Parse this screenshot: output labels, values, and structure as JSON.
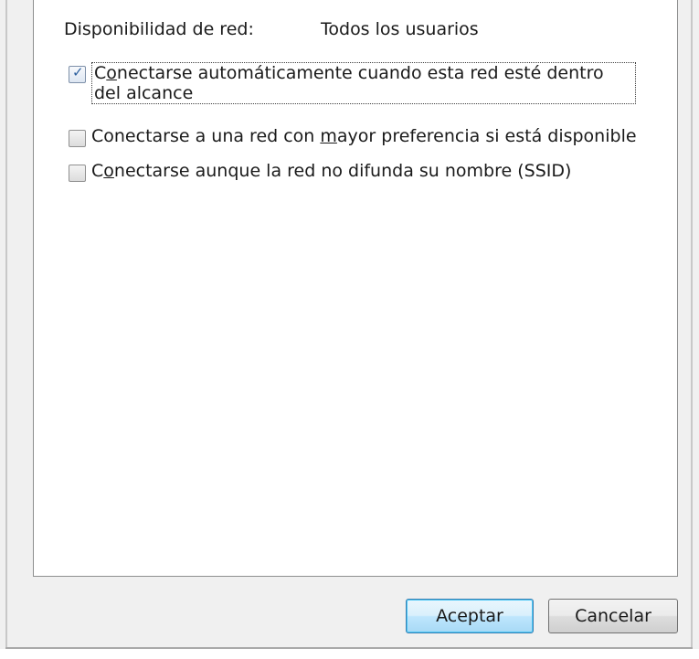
{
  "availability": {
    "label": "Disponibilidad de red:",
    "value": "Todos los usuarios"
  },
  "options": [
    {
      "label_prefix": "C",
      "label_accel": "o",
      "label_rest": "nectarse automáticamente cuando esta red esté dentro del alcance",
      "checked": true
    },
    {
      "label_prefix": "Conectarse a una red con ",
      "label_accel": "m",
      "label_rest": "ayor preferencia si está disponible",
      "checked": false
    },
    {
      "label_prefix": "C",
      "label_accel": "o",
      "label_rest": "nectarse aunque la red no difunda su nombre (SSID)",
      "checked": false
    }
  ],
  "buttons": {
    "accept": "Aceptar",
    "cancel": "Cancelar"
  }
}
